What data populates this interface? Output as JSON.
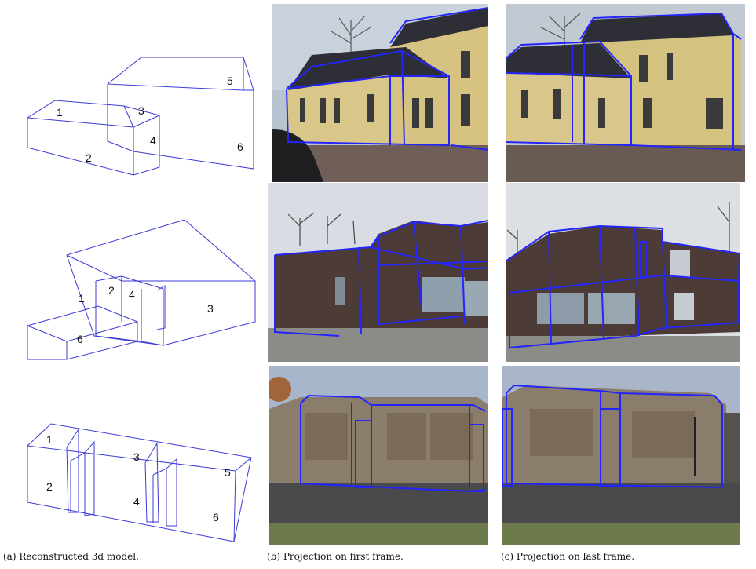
{
  "models": [
    {
      "labels": [
        "1",
        "2",
        "3",
        "4",
        "5",
        "6"
      ]
    },
    {
      "labels": [
        "1",
        "2",
        "3",
        "4",
        "6"
      ]
    },
    {
      "labels": [
        "1",
        "2",
        "3",
        "4",
        "5",
        "6"
      ]
    }
  ],
  "captions": {
    "a": "(a) Reconstructed 3d model.",
    "b": "(b) Projection on first frame.",
    "c": "(c) Projection on last frame."
  },
  "colors": {
    "wireframe": "#3a3ad6",
    "projection": "#2424ff"
  }
}
